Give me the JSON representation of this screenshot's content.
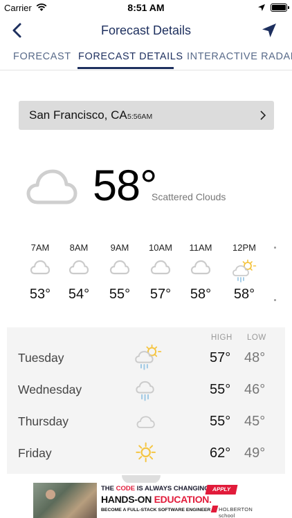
{
  "status_bar": {
    "carrier": "Carrier",
    "time": "8:51 AM"
  },
  "nav": {
    "title": "Forecast Details"
  },
  "tabs": [
    {
      "label": "FORECAST",
      "active": false
    },
    {
      "label": "FORECAST DETAILS",
      "active": true
    },
    {
      "label": "INTERACTIVE RADAR",
      "active": false
    }
  ],
  "location": {
    "name": "San Francisco, CA",
    "time": "5:56AM"
  },
  "current": {
    "temp": "58°",
    "condition": "Scattered Clouds",
    "icon": "cloud-icon"
  },
  "hourly": [
    {
      "time": "7AM",
      "temp": "53°",
      "icon": "cloud-icon"
    },
    {
      "time": "8AM",
      "temp": "54°",
      "icon": "cloud-icon"
    },
    {
      "time": "9AM",
      "temp": "55°",
      "icon": "cloud-icon"
    },
    {
      "time": "10AM",
      "temp": "57°",
      "icon": "cloud-icon"
    },
    {
      "time": "11AM",
      "temp": "58°",
      "icon": "cloud-icon"
    },
    {
      "time": "12PM",
      "temp": "58°",
      "icon": "sun-rain-cloud-icon"
    }
  ],
  "daily": {
    "high_label": "HIGH",
    "low_label": "LOW",
    "days": [
      {
        "name": "Tuesday",
        "icon": "sun-rain-cloud-icon",
        "high": "57°",
        "low": "48°"
      },
      {
        "name": "Wednesday",
        "icon": "rain-cloud-icon",
        "high": "55°",
        "low": "46°"
      },
      {
        "name": "Thursday",
        "icon": "cloud-icon",
        "high": "55°",
        "low": "45°"
      },
      {
        "name": "Friday",
        "icon": "sun-icon",
        "high": "62°",
        "low": "49°"
      }
    ]
  },
  "ad": {
    "line1_pre": "THE ",
    "line1_hl": "CODE",
    "line1_post": " IS ALWAYS CHANGING",
    "line2_pre": "HANDS-ON ",
    "line2_hl": "EDUCATION.",
    "line3": "BECOME A FULL-STACK SOFTWARE ENGINEER",
    "apply": "APPLY NOW",
    "brand": "HOLBERTON school",
    "close": "✕"
  },
  "colors": {
    "accent": "#1d2f5e",
    "tab_inactive": "#586a89",
    "sun": "#f5c542",
    "rain": "#9ec8e4",
    "icon_gray": "#c8c8c8"
  }
}
